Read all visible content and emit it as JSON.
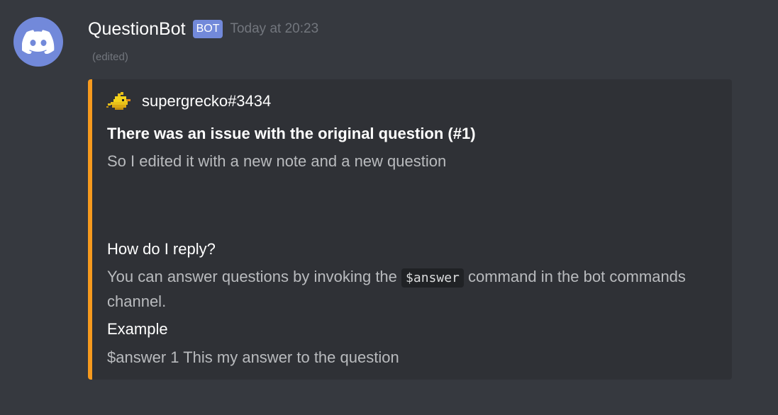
{
  "message": {
    "username": "QuestionBot",
    "bot_tag": "BOT",
    "timestamp": "Today at 20:23",
    "edited": "(edited)",
    "avatar_icon": "discord-logo-icon",
    "colors": {
      "background": "#36393f",
      "avatar": "#7289da",
      "bot_tag": "#7289da",
      "embed_bg": "#2f3136",
      "embed_accent": "#f79a1e"
    }
  },
  "embed": {
    "author": {
      "name": "supergrecko#3434",
      "icon": "pixel-bird-icon"
    },
    "title": "There was an issue with the original question (#1)",
    "description": "So I edited it with a new note and a new question",
    "fields": [
      {
        "name": "How do I reply?",
        "value_before": "You can answer questions by invoking the ",
        "value_code": "$answer",
        "value_after": " command in the bot commands channel."
      },
      {
        "name": "Example",
        "value": "$answer 1 This my answer to the question"
      }
    ]
  }
}
